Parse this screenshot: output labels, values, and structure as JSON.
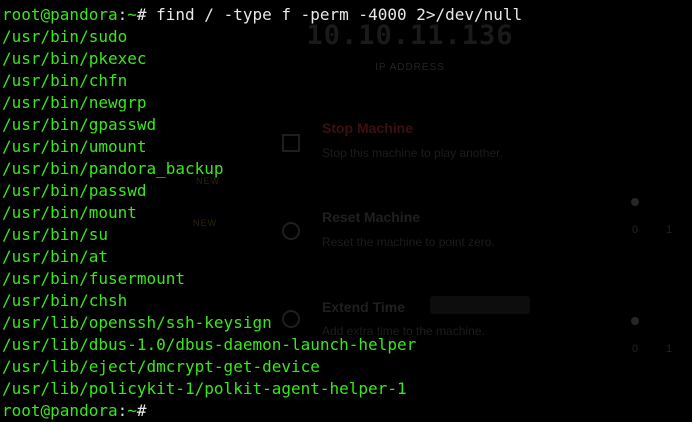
{
  "background_ui": {
    "ip_address": "10.10.11.136",
    "ip_label": "IP ADDRESS",
    "actions": [
      {
        "title": "Stop Machine",
        "description": "Stop this machine to play another."
      },
      {
        "title": "Reset Machine",
        "description": "Reset the machine to point zero."
      },
      {
        "title": "Extend Time",
        "description": "Add extra time to the machine."
      }
    ],
    "badges": [
      "NEW",
      "NEW"
    ],
    "numbers": [
      "0",
      "1",
      "0",
      "1"
    ]
  },
  "terminal": {
    "prompt": {
      "user_host": "root@pandora",
      "separator": ":",
      "path": "~",
      "symbol": "# "
    },
    "command": "find / -type f -perm -4000 2>/dev/null",
    "output": [
      "/usr/bin/sudo",
      "/usr/bin/pkexec",
      "/usr/bin/chfn",
      "/usr/bin/newgrp",
      "/usr/bin/gpasswd",
      "/usr/bin/umount",
      "/usr/bin/pandora_backup",
      "/usr/bin/passwd",
      "/usr/bin/mount",
      "/usr/bin/su",
      "/usr/bin/at",
      "/usr/bin/fusermount",
      "/usr/bin/chsh",
      "/usr/lib/openssh/ssh-keysign",
      "/usr/lib/dbus-1.0/dbus-daemon-launch-helper",
      "/usr/lib/eject/dmcrypt-get-device",
      "/usr/lib/policykit-1/polkit-agent-helper-1"
    ],
    "colors": {
      "background": "#000000",
      "prompt_green": "#39e81a",
      "output_green": "#39e81a",
      "command_text": "#e8e8e8"
    }
  }
}
